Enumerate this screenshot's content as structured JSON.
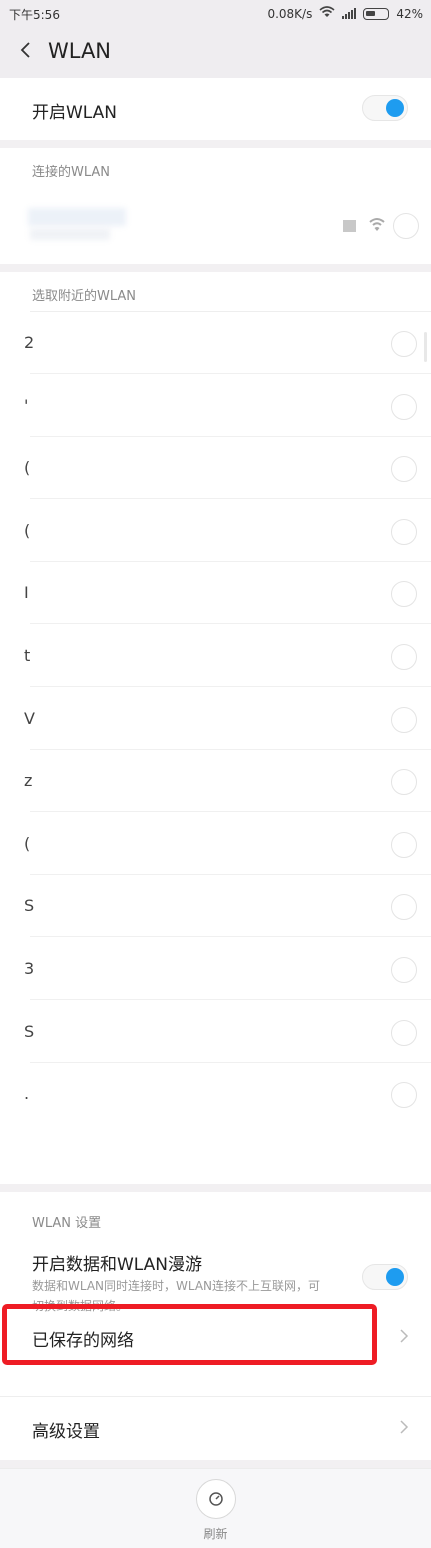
{
  "status_bar": {
    "time": "下午5:56",
    "network_speed": "0.08K/s",
    "battery": "42%"
  },
  "header": {
    "title": "WLAN"
  },
  "wlan_toggle": {
    "label": "开启WLAN",
    "on": true
  },
  "connected": {
    "section_label": "连接的WLAN"
  },
  "nearby": {
    "section_label": "选取附近的WLAN",
    "networks": [
      {
        "label": "2"
      },
      {
        "label": "'"
      },
      {
        "label": "("
      },
      {
        "label": "("
      },
      {
        "label": "I"
      },
      {
        "label": "t"
      },
      {
        "label": "V"
      },
      {
        "label": "z"
      },
      {
        "label": "("
      },
      {
        "label": "S"
      },
      {
        "label": "3"
      },
      {
        "label": "S"
      },
      {
        "label": "."
      }
    ]
  },
  "settings": {
    "section_label": "WLAN 设置",
    "roaming_title": "开启数据和WLAN漫游",
    "roaming_desc": "数据和WLAN同时连接时，WLAN连接不上互联网，可切换到数据网络。",
    "roaming_on": true,
    "saved_networks": "已保存的网络",
    "advanced": "高级设置"
  },
  "bottom_bar": {
    "refresh_label": "刷新"
  },
  "colors": {
    "accent": "#1e9cf0",
    "highlight": "#ee1c24"
  }
}
